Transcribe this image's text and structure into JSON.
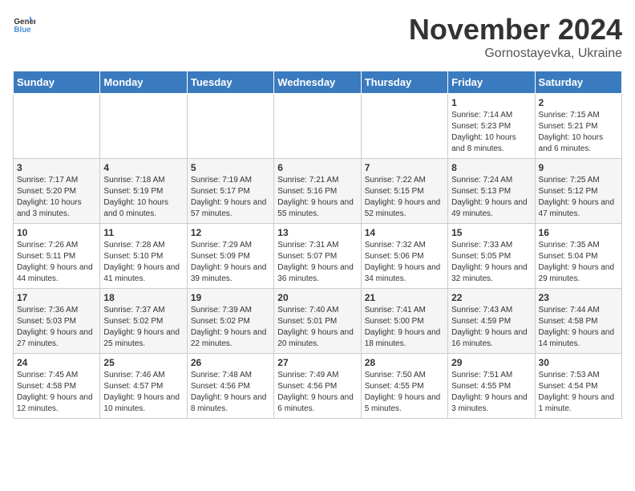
{
  "logo": {
    "text_general": "General",
    "text_blue": "Blue"
  },
  "header": {
    "month_year": "November 2024",
    "location": "Gornostayevka, Ukraine"
  },
  "days_of_week": [
    "Sunday",
    "Monday",
    "Tuesday",
    "Wednesday",
    "Thursday",
    "Friday",
    "Saturday"
  ],
  "weeks": [
    {
      "days": [
        {
          "number": "",
          "info": ""
        },
        {
          "number": "",
          "info": ""
        },
        {
          "number": "",
          "info": ""
        },
        {
          "number": "",
          "info": ""
        },
        {
          "number": "",
          "info": ""
        },
        {
          "number": "1",
          "info": "Sunrise: 7:14 AM\nSunset: 5:23 PM\nDaylight: 10 hours and 8 minutes."
        },
        {
          "number": "2",
          "info": "Sunrise: 7:15 AM\nSunset: 5:21 PM\nDaylight: 10 hours and 6 minutes."
        }
      ]
    },
    {
      "days": [
        {
          "number": "3",
          "info": "Sunrise: 7:17 AM\nSunset: 5:20 PM\nDaylight: 10 hours and 3 minutes."
        },
        {
          "number": "4",
          "info": "Sunrise: 7:18 AM\nSunset: 5:19 PM\nDaylight: 10 hours and 0 minutes."
        },
        {
          "number": "5",
          "info": "Sunrise: 7:19 AM\nSunset: 5:17 PM\nDaylight: 9 hours and 57 minutes."
        },
        {
          "number": "6",
          "info": "Sunrise: 7:21 AM\nSunset: 5:16 PM\nDaylight: 9 hours and 55 minutes."
        },
        {
          "number": "7",
          "info": "Sunrise: 7:22 AM\nSunset: 5:15 PM\nDaylight: 9 hours and 52 minutes."
        },
        {
          "number": "8",
          "info": "Sunrise: 7:24 AM\nSunset: 5:13 PM\nDaylight: 9 hours and 49 minutes."
        },
        {
          "number": "9",
          "info": "Sunrise: 7:25 AM\nSunset: 5:12 PM\nDaylight: 9 hours and 47 minutes."
        }
      ]
    },
    {
      "days": [
        {
          "number": "10",
          "info": "Sunrise: 7:26 AM\nSunset: 5:11 PM\nDaylight: 9 hours and 44 minutes."
        },
        {
          "number": "11",
          "info": "Sunrise: 7:28 AM\nSunset: 5:10 PM\nDaylight: 9 hours and 41 minutes."
        },
        {
          "number": "12",
          "info": "Sunrise: 7:29 AM\nSunset: 5:09 PM\nDaylight: 9 hours and 39 minutes."
        },
        {
          "number": "13",
          "info": "Sunrise: 7:31 AM\nSunset: 5:07 PM\nDaylight: 9 hours and 36 minutes."
        },
        {
          "number": "14",
          "info": "Sunrise: 7:32 AM\nSunset: 5:06 PM\nDaylight: 9 hours and 34 minutes."
        },
        {
          "number": "15",
          "info": "Sunrise: 7:33 AM\nSunset: 5:05 PM\nDaylight: 9 hours and 32 minutes."
        },
        {
          "number": "16",
          "info": "Sunrise: 7:35 AM\nSunset: 5:04 PM\nDaylight: 9 hours and 29 minutes."
        }
      ]
    },
    {
      "days": [
        {
          "number": "17",
          "info": "Sunrise: 7:36 AM\nSunset: 5:03 PM\nDaylight: 9 hours and 27 minutes."
        },
        {
          "number": "18",
          "info": "Sunrise: 7:37 AM\nSunset: 5:02 PM\nDaylight: 9 hours and 25 minutes."
        },
        {
          "number": "19",
          "info": "Sunrise: 7:39 AM\nSunset: 5:02 PM\nDaylight: 9 hours and 22 minutes."
        },
        {
          "number": "20",
          "info": "Sunrise: 7:40 AM\nSunset: 5:01 PM\nDaylight: 9 hours and 20 minutes."
        },
        {
          "number": "21",
          "info": "Sunrise: 7:41 AM\nSunset: 5:00 PM\nDaylight: 9 hours and 18 minutes."
        },
        {
          "number": "22",
          "info": "Sunrise: 7:43 AM\nSunset: 4:59 PM\nDaylight: 9 hours and 16 minutes."
        },
        {
          "number": "23",
          "info": "Sunrise: 7:44 AM\nSunset: 4:58 PM\nDaylight: 9 hours and 14 minutes."
        }
      ]
    },
    {
      "days": [
        {
          "number": "24",
          "info": "Sunrise: 7:45 AM\nSunset: 4:58 PM\nDaylight: 9 hours and 12 minutes."
        },
        {
          "number": "25",
          "info": "Sunrise: 7:46 AM\nSunset: 4:57 PM\nDaylight: 9 hours and 10 minutes."
        },
        {
          "number": "26",
          "info": "Sunrise: 7:48 AM\nSunset: 4:56 PM\nDaylight: 9 hours and 8 minutes."
        },
        {
          "number": "27",
          "info": "Sunrise: 7:49 AM\nSunset: 4:56 PM\nDaylight: 9 hours and 6 minutes."
        },
        {
          "number": "28",
          "info": "Sunrise: 7:50 AM\nSunset: 4:55 PM\nDaylight: 9 hours and 5 minutes."
        },
        {
          "number": "29",
          "info": "Sunrise: 7:51 AM\nSunset: 4:55 PM\nDaylight: 9 hours and 3 minutes."
        },
        {
          "number": "30",
          "info": "Sunrise: 7:53 AM\nSunset: 4:54 PM\nDaylight: 9 hours and 1 minute."
        }
      ]
    }
  ]
}
